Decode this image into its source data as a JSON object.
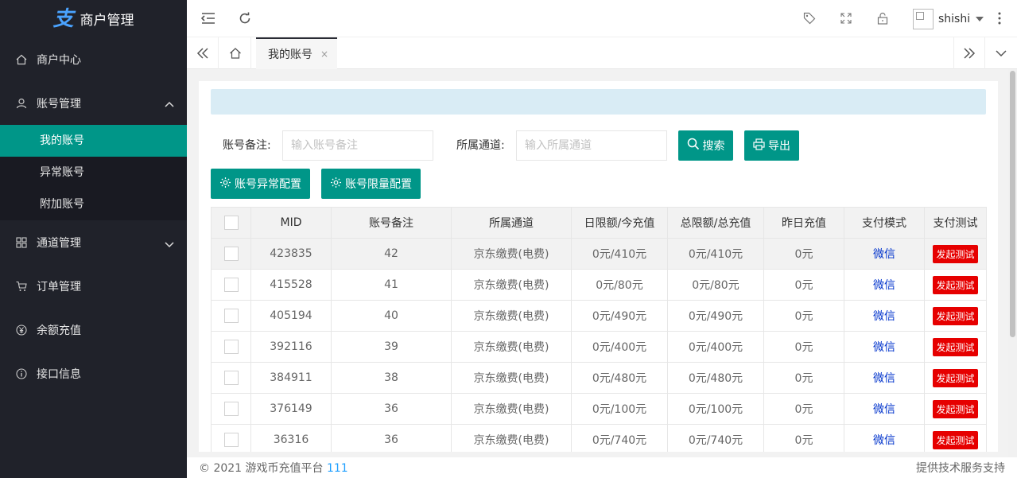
{
  "app": {
    "logo_mark": "支",
    "title": "商户管理"
  },
  "sidebar": {
    "items": [
      {
        "label": "商户中心",
        "icon": "home-icon"
      },
      {
        "label": "账号管理",
        "icon": "user-icon",
        "expanded": true,
        "children": [
          {
            "label": "我的账号",
            "active": true
          },
          {
            "label": "异常账号"
          },
          {
            "label": "附加账号"
          }
        ]
      },
      {
        "label": "通道管理",
        "icon": "grid-icon"
      },
      {
        "label": "订单管理",
        "icon": "cart-icon"
      },
      {
        "label": "余额充值",
        "icon": "yen-icon"
      },
      {
        "label": "接口信息",
        "icon": "info-icon"
      }
    ]
  },
  "header": {
    "username": "shishi"
  },
  "tabs": {
    "active_label": "我的账号",
    "close_glyph": "×"
  },
  "filters": {
    "note_label": "账号备注:",
    "note_placeholder": "输入账号备注",
    "channel_label": "所属通道:",
    "channel_placeholder": "输入所属通道",
    "search_label": "搜索",
    "export_label": "导出",
    "abnormal_config_label": "账号异常配置",
    "limit_config_label": "账号限量配置"
  },
  "table": {
    "columns": [
      "MID",
      "账号备注",
      "所属通道",
      "日限额/今充值",
      "总限额/总充值",
      "昨日充值",
      "支付模式",
      "支付测试"
    ],
    "rows": [
      {
        "mid": "423835",
        "note": "42",
        "channel": "京东缴费(电费)",
        "daily": "0元/410元",
        "total": "0元/410元",
        "yesterday": "0元",
        "mode": "微信",
        "test": "发起测试"
      },
      {
        "mid": "415528",
        "note": "41",
        "channel": "京东缴费(电费)",
        "daily": "0元/80元",
        "total": "0元/80元",
        "yesterday": "0元",
        "mode": "微信",
        "test": "发起测试"
      },
      {
        "mid": "405194",
        "note": "40",
        "channel": "京东缴费(电费)",
        "daily": "0元/490元",
        "total": "0元/490元",
        "yesterday": "0元",
        "mode": "微信",
        "test": "发起测试"
      },
      {
        "mid": "392116",
        "note": "39",
        "channel": "京东缴费(电费)",
        "daily": "0元/400元",
        "total": "0元/400元",
        "yesterday": "0元",
        "mode": "微信",
        "test": "发起测试"
      },
      {
        "mid": "384911",
        "note": "38",
        "channel": "京东缴费(电费)",
        "daily": "0元/480元",
        "total": "0元/480元",
        "yesterday": "0元",
        "mode": "微信",
        "test": "发起测试"
      },
      {
        "mid": "376149",
        "note": "36",
        "channel": "京东缴费(电费)",
        "daily": "0元/100元",
        "total": "0元/100元",
        "yesterday": "0元",
        "mode": "微信",
        "test": "发起测试"
      },
      {
        "mid": "36316",
        "note": "36",
        "channel": "京东缴费(电费)",
        "daily": "0元/740元",
        "total": "0元/740元",
        "yesterday": "0元",
        "mode": "微信",
        "test": "发起测试"
      }
    ]
  },
  "footer": {
    "copyright": "© 2021 游戏币充值平台",
    "number": "111",
    "support": "提供技术服务支持"
  },
  "colors": {
    "sidebar_bg": "#20222a",
    "accent": "#009688",
    "danger": "#e60000",
    "link": "#0033cc"
  }
}
